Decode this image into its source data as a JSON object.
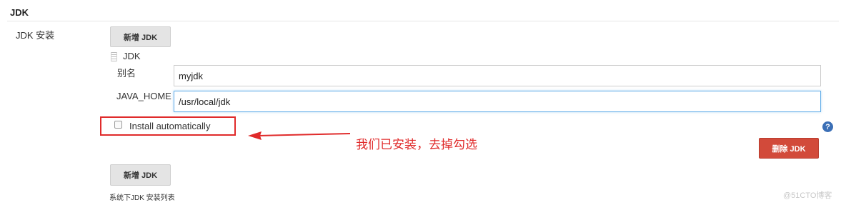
{
  "section": {
    "title": "JDK"
  },
  "jdk_install": {
    "label": "JDK 安装",
    "add_button_top": "新增 JDK",
    "item": {
      "title": "JDK",
      "alias_label": "别名",
      "alias_value": "myjdk",
      "java_home_label": "JAVA_HOME",
      "java_home_value": "/usr/local/jdk",
      "install_auto_label": "Install automatically",
      "install_auto_checked": false,
      "help_icon": "?",
      "delete_button": "删除 JDK"
    },
    "add_button_bottom": "新增 JDK",
    "list_caption": "系统下JDK 安装列表"
  },
  "annotation": {
    "text": "我们已安装，去掉勾选",
    "color": "#e02b2b"
  },
  "watermark": "@51CTO博客",
  "colors": {
    "delete_button": "#d24a3a",
    "focus_border": "#66afe9",
    "help_icon": "#3b6fb6"
  }
}
